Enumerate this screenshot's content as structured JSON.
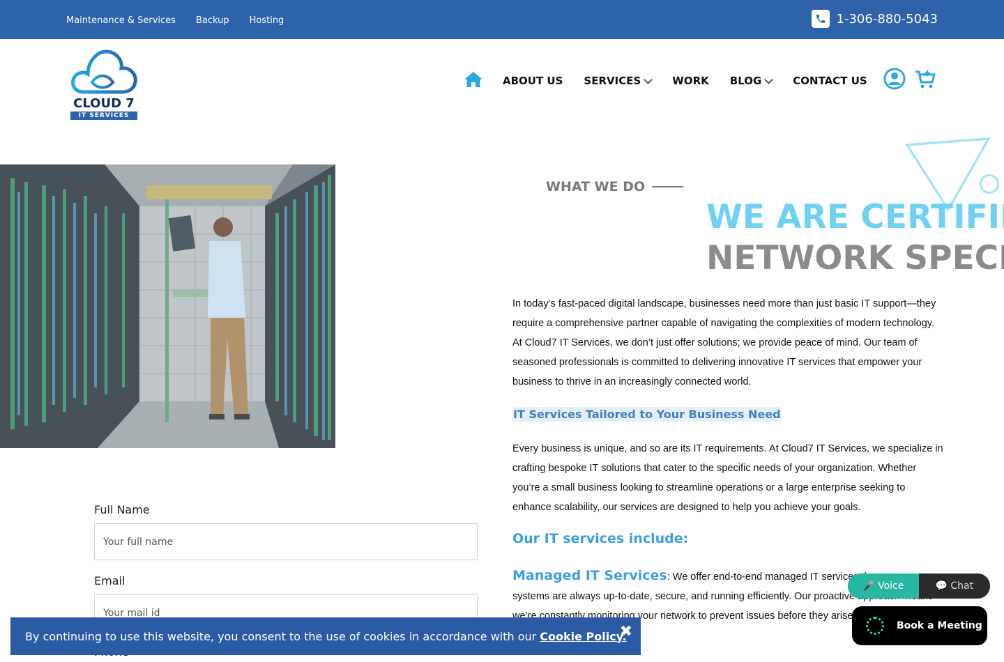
{
  "topbar": {
    "links": [
      "Maintenance & Services",
      "Backup",
      "Hosting"
    ],
    "phone": "1-306-880-5043"
  },
  "logo": {
    "line1": "CLOUD 7",
    "line2": "IT SERVICES"
  },
  "nav": {
    "items": [
      {
        "label": "ABOUT US",
        "dropdown": false
      },
      {
        "label": "SERVICES",
        "dropdown": true
      },
      {
        "label": "WORK",
        "dropdown": false
      },
      {
        "label": "BLOG",
        "dropdown": true
      },
      {
        "label": "CONTACT US",
        "dropdown": false
      }
    ]
  },
  "section": {
    "eyebrow": "WHAT WE DO",
    "headline1": "WE ARE CERTIFIED",
    "headline2": "NETWORK SPECIA",
    "para1": "In today’s fast-paced digital landscape, businesses need more than just basic IT support—they require a comprehensive partner capable of navigating the complexities of modern technology. At Cloud7 IT Services, we don’t just offer solutions; we provide peace of mind. Our team of seasoned professionals is committed to delivering innovative IT services that empower your business to thrive in an increasingly connected world.",
    "subhead": "IT Services Tailored to Your Business Need",
    "para2": "Every business is unique, and so are its IT requirements. At Cloud7 IT Services, we specialize in crafting bespoke IT solutions that cater to the specific needs of your organization. Whether you’re a small business looking to streamline operations or a large enterprise seeking to enhance scalability, our services are designed to help you achieve your goals.",
    "services_head": "Our IT services include:",
    "managed_label": "Managed IT Services",
    "managed_text": ": We offer end-to-end managed IT services that ensure your systems are always up-to-date, secure, and running efficiently. Our proactive approach means we’re constantly monitoring your network to prevent issues before they arise, so you can focus on core activities."
  },
  "form": {
    "name_label": "Full Name",
    "name_placeholder": "Your full name",
    "email_label": "Email",
    "email_placeholder": "Your mail id",
    "phone_label": "Phone"
  },
  "cookie": {
    "text": "By continuing to use this website, you consent to the use of cookies in accordance with our",
    "link": "Cookie Policy.",
    "close": "✖"
  },
  "widget": {
    "voice": "Voice",
    "chat": "Chat",
    "meeting": "Book a Meeting"
  },
  "colors": {
    "brand": "#2e62ab",
    "accent": "#3d9ee0",
    "headline_light": "#6fd2f2",
    "teal": "#27b8a3"
  }
}
